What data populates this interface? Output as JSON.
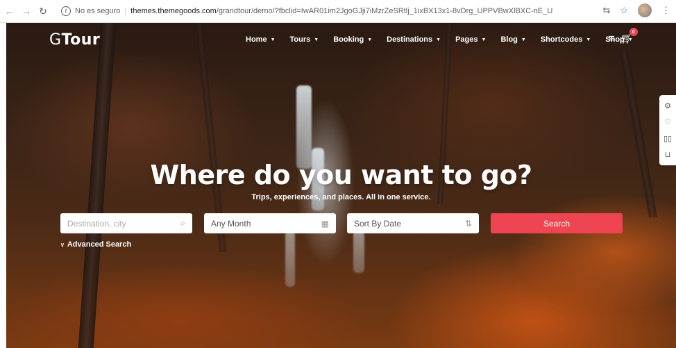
{
  "browser": {
    "security_label": "No es seguro",
    "url_host": "themes.themegoods.com",
    "url_path": "/grandtour/demo/?fbclid=IwAR01im2JgoGJji7iMzrZeSRtlj_1ixBX13x1-8vDrg_UPPVBwXlBXC-nE_U"
  },
  "header": {
    "logo_g": "G",
    "logo_rest": "Tour",
    "menu": [
      {
        "label": "Home"
      },
      {
        "label": "Tours"
      },
      {
        "label": "Booking"
      },
      {
        "label": "Destinations"
      },
      {
        "label": "Pages"
      },
      {
        "label": "Blog"
      },
      {
        "label": "Shortcodes"
      },
      {
        "label": "Shop"
      }
    ],
    "cart_count": "0"
  },
  "hero": {
    "title": "Where do you want to go?",
    "subtitle": "Trips, experiences, and places. All in one service."
  },
  "search": {
    "destination_placeholder": "Destination, city",
    "month_value": "Any Month",
    "sort_value": "Sort By Date",
    "button_label": "Search",
    "advanced_label": "Advanced Search"
  },
  "colors": {
    "accent": "#ef4452"
  }
}
